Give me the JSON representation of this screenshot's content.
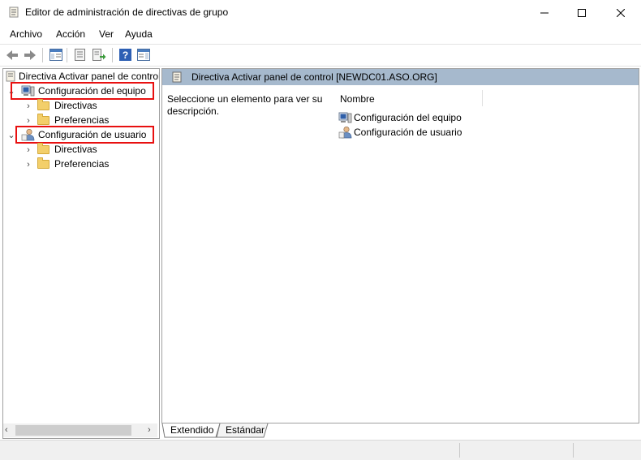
{
  "window": {
    "title": "Editor de administración de directivas de grupo",
    "controls": {
      "minimize": "—",
      "maximize": "☐",
      "close": "✕"
    }
  },
  "menu": {
    "items": [
      "Archivo",
      "Acción",
      "Ver",
      "Ayuda"
    ]
  },
  "toolbar": {
    "buttons": [
      "back-icon",
      "forward-icon",
      "show-hide-tree-icon",
      "properties-icon",
      "export-list-icon",
      "help-icon",
      "show-hide-action-pane-icon"
    ]
  },
  "tree": {
    "root": "Directiva Activar panel de control [NEWDC01.ASO.ORG]",
    "computer_config": "Configuración del equipo",
    "computer_policies": "Directivas",
    "computer_preferences": "Preferencias",
    "user_config": "Configuración de usuario",
    "user_policies": "Directivas",
    "user_preferences": "Preferencias"
  },
  "details": {
    "header": "Directiva Activar panel de control [NEWDC01.ASO.ORG]",
    "description": "Seleccione un elemento para ver su descripción.",
    "column_name": "Nombre",
    "items": [
      "Configuración del equipo",
      "Configuración de usuario"
    ]
  },
  "tabs": [
    "Extendido",
    "Estándar"
  ],
  "colors": {
    "header_band": "#a6b9cd",
    "highlight_box": "#e81010",
    "folder": "#f3cf6a"
  }
}
